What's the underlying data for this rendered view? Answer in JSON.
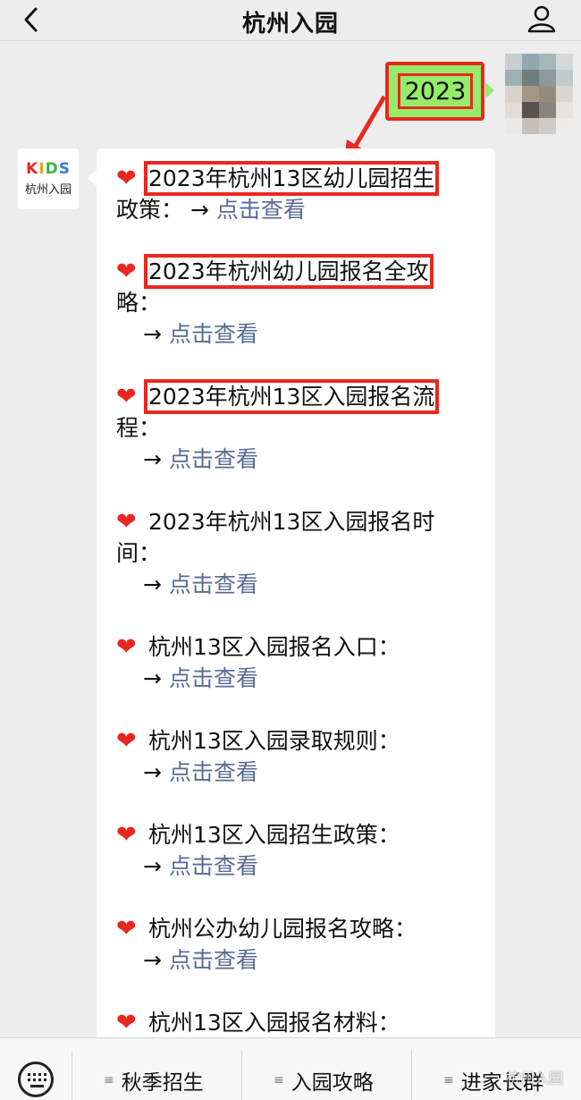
{
  "nav": {
    "title": "杭州入园",
    "back_icon": "chevron-left-icon",
    "profile_icon": "person-icon"
  },
  "sent_message": {
    "text": "2023"
  },
  "account": {
    "logo_text": "KIDS",
    "logo_label": "杭州入园"
  },
  "reply": {
    "heart": "❤️",
    "arrow": "→",
    "items": [
      {
        "title": "2023年杭州13区幼儿园招生",
        "title_cont": "政策：",
        "link": "点击查看"
      },
      {
        "title": "2023年杭州幼儿园报名全攻",
        "title_cont": "略：",
        "link": "点击查看"
      },
      {
        "title": "2023年杭州13区入园报名流",
        "title_cont": "程：",
        "link": "点击查看"
      },
      {
        "title": "2023年杭州13区入园报名时",
        "title_cont": "间：",
        "link": "点击查看"
      },
      {
        "title": "杭州13区入园报名入口：",
        "link": "点击查看"
      },
      {
        "title": "杭州13区入园录取规则：",
        "link": "点击查看"
      },
      {
        "title": "杭州13区入园招生政策：",
        "link": "点击查看"
      },
      {
        "title": "杭州公办幼儿园报名攻略：",
        "link": "点击查看"
      },
      {
        "title": "杭州13区入园报名材料："
      }
    ]
  },
  "bottom_menu": {
    "items": [
      {
        "label": "秋季招生",
        "icon": "≡"
      },
      {
        "label": "入园攻略",
        "icon": "≡"
      },
      {
        "label": "进家长群",
        "icon": "≡"
      }
    ],
    "watermark": "杭州入园"
  },
  "colors": {
    "highlight": "#e8281f",
    "sent_bubble": "#95ec69",
    "link": "#576b95"
  }
}
